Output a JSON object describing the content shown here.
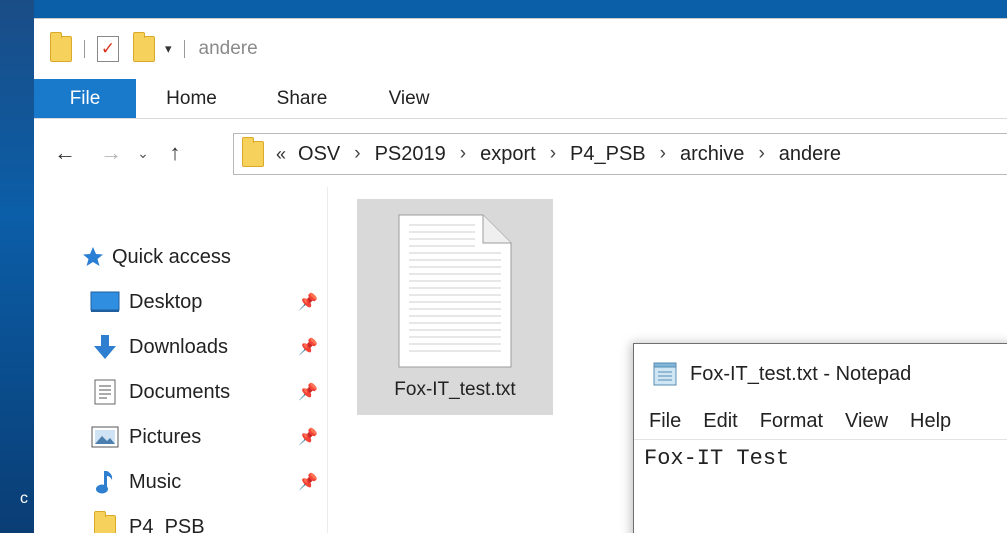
{
  "desktop": {
    "partial_char": "c"
  },
  "explorer": {
    "title": "andere",
    "ribbon_tabs": [
      "File",
      "Home",
      "Share",
      "View"
    ],
    "breadcrumb": {
      "overflow": "«",
      "items": [
        "OSV",
        "PS2019",
        "export",
        "P4_PSB",
        "archive",
        "andere"
      ]
    },
    "nav": {
      "quick_access": "Quick access",
      "items": [
        {
          "label": "Desktop",
          "pinned": true,
          "icon": "desktop-icon"
        },
        {
          "label": "Downloads",
          "pinned": true,
          "icon": "download-arrow-icon"
        },
        {
          "label": "Documents",
          "pinned": true,
          "icon": "document-icon"
        },
        {
          "label": "Pictures",
          "pinned": true,
          "icon": "pictures-icon"
        },
        {
          "label": "Music",
          "pinned": true,
          "icon": "music-note-icon"
        },
        {
          "label": "P4_PSB",
          "pinned": false,
          "icon": "folder-icon"
        }
      ]
    },
    "files": [
      {
        "name": "Fox-IT_test.txt",
        "selected": true,
        "icon": "text-file-icon"
      }
    ]
  },
  "notepad": {
    "title": "Fox-IT_test.txt - Notepad",
    "menu": [
      "File",
      "Edit",
      "Format",
      "View",
      "Help"
    ],
    "content": "Fox-IT Test"
  },
  "colors": {
    "ribbon_file_tab": "#1979ca",
    "selection": "#d9d9d9",
    "folder": "#f6d25c",
    "desktop": "#0b5ea8"
  }
}
